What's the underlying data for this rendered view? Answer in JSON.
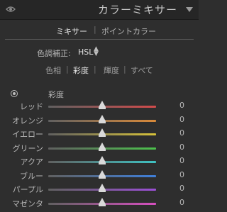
{
  "panel": {
    "title": "カラーミキサー",
    "visibility_icon": "eye-icon",
    "collapse_icon": "triangle-down-icon"
  },
  "mode_tabs": {
    "mixer": "ミキサー",
    "separator": "|",
    "point_color": "ポイントカラー"
  },
  "adjust": {
    "label": "色調補正:",
    "value": "HSL",
    "arrows_icon": "up-down-arrows-icon"
  },
  "sub_tabs": {
    "hue": "色相",
    "saturation": "彩度",
    "luminance": "輝度",
    "all": "すべて",
    "separator": "|",
    "active": "彩度"
  },
  "section": {
    "title": "彩度",
    "target_icon": "target-adjustment-icon"
  },
  "sliders": [
    {
      "label": "レッド",
      "value": "0",
      "level": 0,
      "min": -100,
      "max": 100,
      "colors": [
        "#606060",
        "#d24b4b"
      ]
    },
    {
      "label": "オレンジ",
      "value": "0",
      "level": 0,
      "min": -100,
      "max": 100,
      "colors": [
        "#606060",
        "#d98a3a"
      ]
    },
    {
      "label": "イエロー",
      "value": "0",
      "level": 0,
      "min": -100,
      "max": 100,
      "colors": [
        "#606060",
        "#d7c23a"
      ]
    },
    {
      "label": "グリーン",
      "value": "0",
      "level": 0,
      "min": -100,
      "max": 100,
      "colors": [
        "#606060",
        "#4cc24c"
      ]
    },
    {
      "label": "アクア",
      "value": "0",
      "level": 0,
      "min": -100,
      "max": 100,
      "colors": [
        "#606060",
        "#3fc2c2"
      ]
    },
    {
      "label": "ブルー",
      "value": "0",
      "level": 0,
      "min": -100,
      "max": 100,
      "colors": [
        "#606060",
        "#3f7fd9"
      ]
    },
    {
      "label": "パープル",
      "value": "0",
      "level": 0,
      "min": -100,
      "max": 100,
      "colors": [
        "#606060",
        "#9b4fd6"
      ]
    },
    {
      "label": "マゼンタ",
      "value": "0",
      "level": 0,
      "min": -100,
      "max": 100,
      "colors": [
        "#606060",
        "#d64fc0"
      ]
    }
  ]
}
